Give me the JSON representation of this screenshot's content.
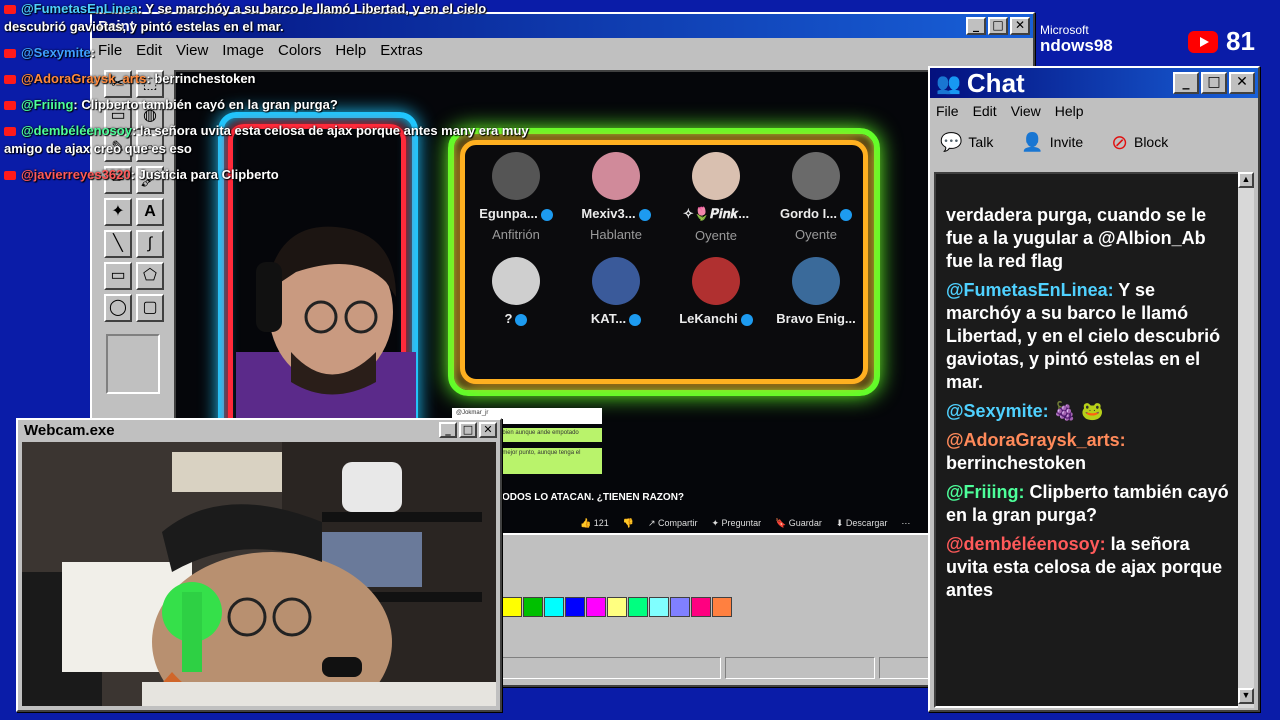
{
  "overlay_chat": [
    {
      "user": "@FumetasEnLinea",
      "user_color": "#4fd1ff",
      "text": ": Y se marchóy a su barco le llamó Libertad, y en el cielo descubrió gaviotas, y pintó estelas en el mar."
    },
    {
      "user": "@Sexymite",
      "user_color": "#3ea0ff",
      "text": ":"
    },
    {
      "user": "@AdoraGraysk_arts",
      "user_color": "#ff8a3d",
      "text": ": berrinchestoken"
    },
    {
      "user": "@Friiing",
      "user_color": "#4dff9a",
      "text": ": Clipberto también cayó en la gran purga?"
    },
    {
      "user": "@dembéléenosoy",
      "user_color": "#4dff9a",
      "text": ": la señora uvita esta celosa de ajax porque antes many era muy amigo de ajax creo que es eso"
    },
    {
      "user": "@javierreyes3620",
      "user_color": "#ff5a5a",
      "text": ": Justicia para Clipberto"
    }
  ],
  "brand": {
    "line1": "Microsoft",
    "line2": "ndows98"
  },
  "viewers": {
    "count": "81"
  },
  "paint": {
    "title": "Paint",
    "menu": [
      "File",
      "Edit",
      "View",
      "Image",
      "Colors",
      "Help",
      "Extras"
    ],
    "controls": {
      "min": "_",
      "max": "□",
      "close": "✕"
    }
  },
  "space": {
    "participants": [
      {
        "name": "Egunpa...",
        "role": "Anfitrión",
        "color": "#555"
      },
      {
        "name": "Mexiv3...",
        "role": "Hablante",
        "color": "#d08a9a"
      },
      {
        "name": "✧🌷𝑷𝒊𝒏𝒌...",
        "role": "Oyente",
        "color": "#d9c0b0"
      },
      {
        "name": "Gordo I...",
        "role": "Oyente",
        "color": "#6a6a6a"
      },
      {
        "name": "?",
        "role": "",
        "color": "#cfcfcf"
      },
      {
        "name": "KAT...",
        "role": "",
        "color": "#3a5a9a"
      },
      {
        "name": "LeKanchi",
        "role": "",
        "color": "#b03030"
      },
      {
        "name": "Bravo Enig...",
        "role": "",
        "color": "#3a6a9a"
      }
    ],
    "video_title": "ODOS LO ATACAN. ¿TIENEN RAZON?",
    "actions": [
      "👍 121",
      "👎",
      "↗ Compartir",
      "✦ Preguntar",
      "🔖 Guardar",
      "⬇ Descargar",
      "⋯"
    ],
    "bubbles": [
      "@Jokmar_jr",
      "pero eso no esta bien aunque ande empotado",
      "el mejor punto, aunque tenga el"
    ],
    "palette": [
      "#ffff00",
      "#00c000",
      "#00ffff",
      "#0000ff",
      "#ff00ff",
      "#ffff80",
      "#00ff80",
      "#80ffff",
      "#8080ff",
      "#ff0080",
      "#ff8040"
    ]
  },
  "webcam": {
    "title": "Webcam.exe",
    "controls": {
      "min": "_",
      "max": "□",
      "close": "✕"
    }
  },
  "chat": {
    "title": "Chat",
    "menu": [
      "File",
      "Edit",
      "View",
      "Help"
    ],
    "toolbar": [
      "Talk",
      "Invite",
      "Block"
    ],
    "controls": {
      "min": "_",
      "max": "□",
      "close": "✕"
    },
    "messages": [
      {
        "user": "",
        "user_color": "#ffffff",
        "text": "verdadera purga, cuando se le fue a la yugular a @Albion_Ab fue la red flag"
      },
      {
        "user": "@FumetasEnLinea:",
        "user_color": "#4fd1ff",
        "text": " Y se marchóy a su barco le llamó Libertad, y en el cielo descubrió gaviotas, y pintó estelas en el mar."
      },
      {
        "user": "@Sexymite:",
        "user_color": "#4fd1ff",
        "text": " 🍇 🐸"
      },
      {
        "user": "@AdoraGraysk_arts:",
        "user_color": "#ff8a5a",
        "text": " berrinchestoken"
      },
      {
        "user": "@Friiing:",
        "user_color": "#4dff9a",
        "text": " Clipberto también cayó en la gran purga?"
      },
      {
        "user": "@dembéléenosoy:",
        "user_color": "#ff5a5a",
        "text": " la señora uvita esta celosa de ajax porque antes"
      }
    ]
  }
}
